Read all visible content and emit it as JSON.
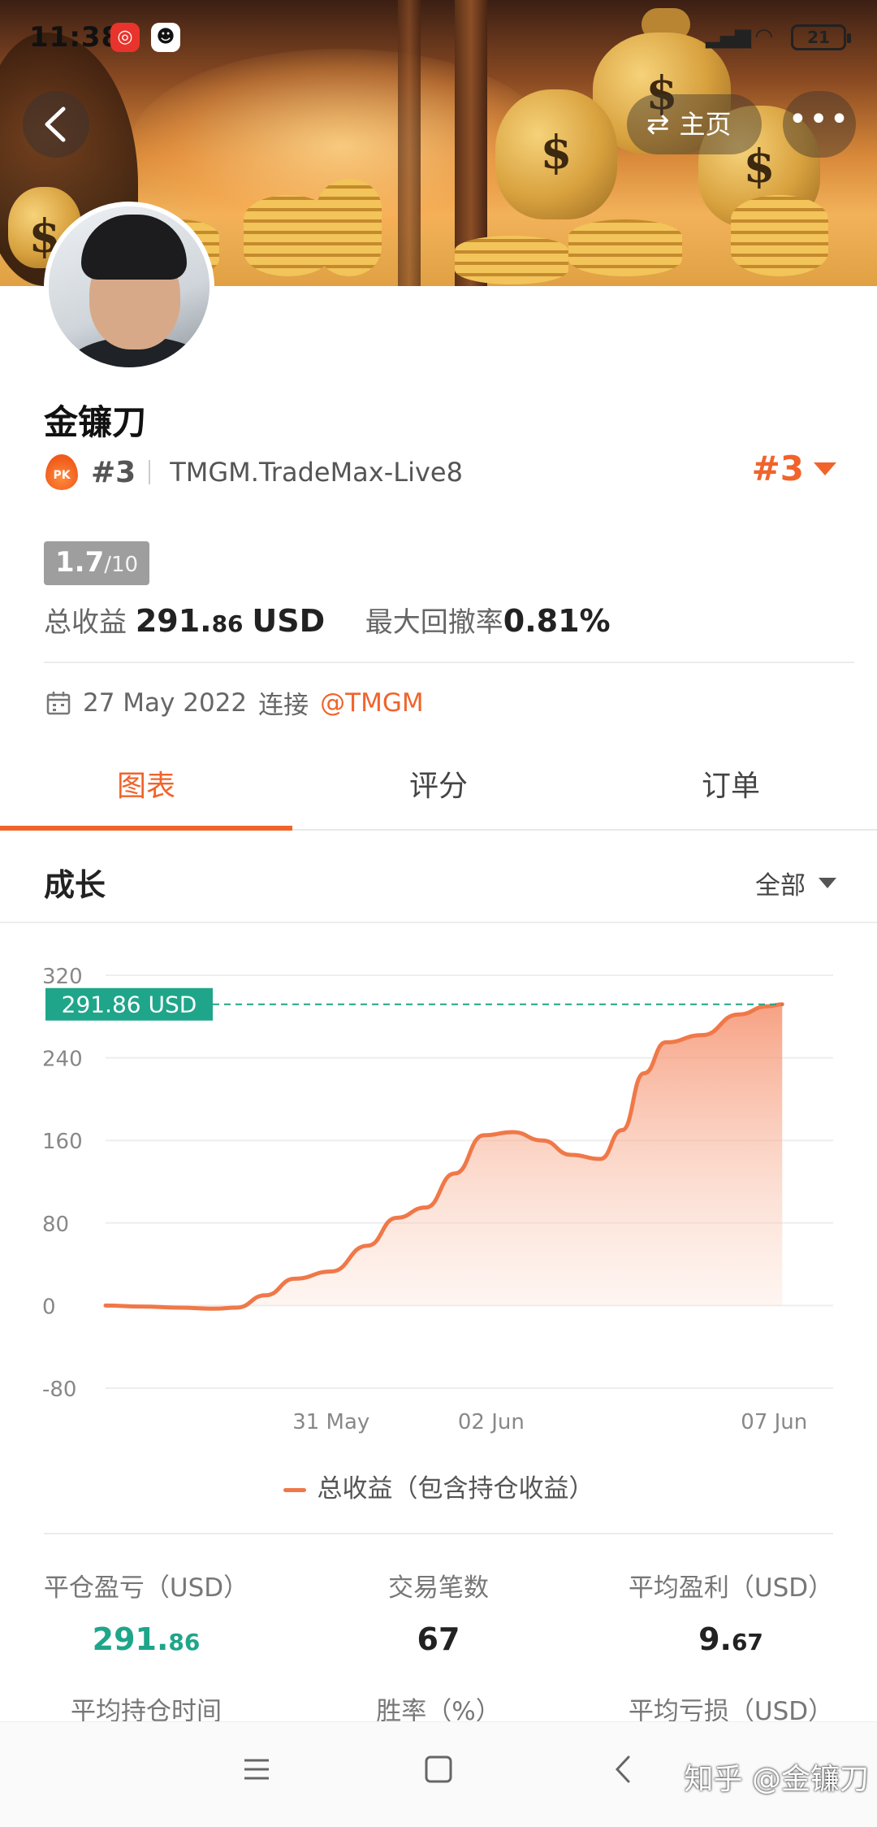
{
  "status_bar": {
    "time": "11:38",
    "battery": "21"
  },
  "header": {
    "home_label": "主页",
    "more_label": "•••"
  },
  "profile": {
    "name": "金镰刀",
    "pk_badge": "PK",
    "rank": "#3",
    "server": "TMGM.TradeMax-Live8",
    "rank_right": "#3",
    "score_main": "1.7",
    "score_suffix": "/10",
    "total_profit_label": "总收益",
    "total_profit_int": "291.",
    "total_profit_dec": "86",
    "total_profit_unit": "USD",
    "drawdown_label": "最大回撤率",
    "drawdown_value": "0.81%",
    "date": "27 May 2022",
    "connect_label": "连接",
    "broker_link": "@TMGM"
  },
  "tabs": [
    {
      "label": "图表",
      "active": true
    },
    {
      "label": "评分",
      "active": false
    },
    {
      "label": "订单",
      "active": false
    }
  ],
  "growth": {
    "title": "成长",
    "range": "全部"
  },
  "chart_data": {
    "type": "area",
    "title": "",
    "xlabel": "",
    "ylabel": "",
    "ylim": [
      -80,
      320
    ],
    "yticks": [
      "320",
      "240",
      "160",
      "80",
      "0",
      "-80"
    ],
    "xticks": [
      "31 May",
      "02 Jun",
      "07 Jun"
    ],
    "current_label": "291.86 USD",
    "current_value": 291.86,
    "series": [
      {
        "name": "总收益（包含持仓收益）",
        "color": "#f07848",
        "points": [
          [
            0.0,
            0
          ],
          [
            0.05,
            -1
          ],
          [
            0.1,
            -2
          ],
          [
            0.15,
            -3
          ],
          [
            0.18,
            -2
          ],
          [
            0.22,
            10
          ],
          [
            0.26,
            26
          ],
          [
            0.31,
            33
          ],
          [
            0.36,
            58
          ],
          [
            0.4,
            85
          ],
          [
            0.44,
            95
          ],
          [
            0.48,
            128
          ],
          [
            0.52,
            165
          ],
          [
            0.56,
            168
          ],
          [
            0.6,
            160
          ],
          [
            0.64,
            146
          ],
          [
            0.68,
            142
          ],
          [
            0.71,
            170
          ],
          [
            0.74,
            225
          ],
          [
            0.77,
            255
          ],
          [
            0.82,
            262
          ],
          [
            0.87,
            282
          ],
          [
            0.91,
            290
          ],
          [
            0.93,
            291.86
          ]
        ]
      }
    ]
  },
  "legend_label": "总收益（包含持仓收益）",
  "stats": [
    {
      "label": "平仓盈亏（USD）",
      "int": "291.",
      "dec": "86",
      "green": true
    },
    {
      "label": "交易笔数",
      "int": "67",
      "dec": "",
      "green": false
    },
    {
      "label": "平均盈利（USD）",
      "int": "9.",
      "dec": "67",
      "green": false
    },
    {
      "label": "平均持仓时间",
      "int": "",
      "dec": "",
      "green": false
    },
    {
      "label": "胜率（%）",
      "int": "",
      "dec": "",
      "green": false
    },
    {
      "label": "平均亏损（USD）",
      "int": "",
      "dec": "",
      "green": false
    }
  ],
  "watermark": "知乎 @金镰刀"
}
